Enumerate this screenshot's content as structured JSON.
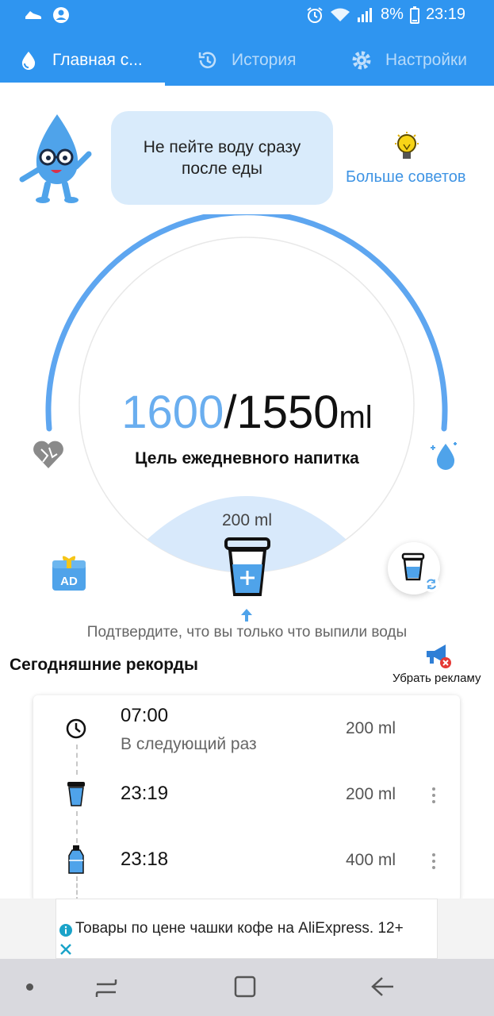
{
  "status_bar": {
    "battery_percent": "8%",
    "time": "23:19"
  },
  "tabs": [
    {
      "label": "Главная с...",
      "icon": "water-drop-icon",
      "active": true
    },
    {
      "label": "История",
      "icon": "history-icon",
      "active": false
    },
    {
      "label": "Настройки",
      "icon": "gear-icon",
      "active": false
    }
  ],
  "tip": {
    "text": "Не пейте воду сразу после еды",
    "more_tips_label": "Больше советов"
  },
  "progress": {
    "current": "1600",
    "goal": "/1550",
    "unit": "ml",
    "goal_label": "Цель ежедневного напитка",
    "cup_size": "200 ml",
    "confirm_text": "Подтвердите, что вы только что выпили воды"
  },
  "records": {
    "title": "Сегодняшние рекорды",
    "remove_ads_label": "Убрать рекламу",
    "items": [
      {
        "time": "07:00",
        "subtitle": "В следующий раз",
        "amount": "200 ml",
        "icon": "clock-icon"
      },
      {
        "time": "23:19",
        "amount": "200 ml",
        "icon": "cup-icon"
      },
      {
        "time": "23:18",
        "amount": "400 ml",
        "icon": "bottle-icon"
      }
    ]
  },
  "ad_banner": {
    "text": "Товары по цене чашки кофе на AliExpress. 12+"
  },
  "colors": {
    "primary": "#2f95f0",
    "accent_blue": "#6aaeef",
    "link": "#3f94e4",
    "bubble": "#d9ebfb"
  }
}
